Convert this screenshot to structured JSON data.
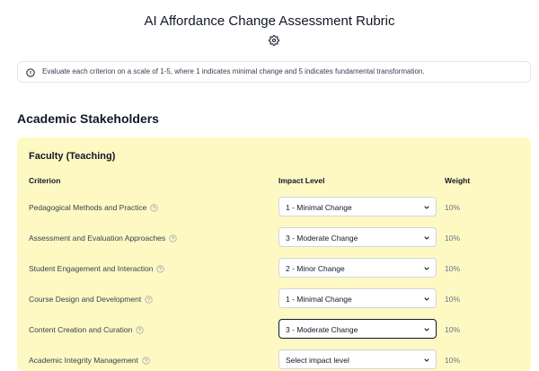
{
  "header": {
    "title": "AI Affordance Change Assessment Rubric",
    "settings_icon": "gear-icon"
  },
  "info": {
    "icon": "info-icon",
    "text": "Evaluate each criterion on a scale of 1-5, where 1 indicates minimal change and 5 indicates fundamental transformation."
  },
  "section": {
    "title": "Academic Stakeholders"
  },
  "card": {
    "title": "Faculty (Teaching)",
    "background": "#fef9c3",
    "columns": {
      "criterion": "Criterion",
      "impact": "Impact Level",
      "weight": "Weight"
    },
    "rows": [
      {
        "criterion": "Pedagogical Methods and Practice",
        "impact": "1 - Minimal Change",
        "weight": "10%"
      },
      {
        "criterion": "Assessment and Evaluation Approaches",
        "impact": "3 - Moderate Change",
        "weight": "10%"
      },
      {
        "criterion": "Student Engagement and Interaction",
        "impact": "2 - Minor Change",
        "weight": "10%"
      },
      {
        "criterion": "Course Design and Development",
        "impact": "1 - Minimal Change",
        "weight": "10%"
      },
      {
        "criterion": "Content Creation and Curation",
        "impact": "3 - Moderate Change",
        "weight": "10%"
      },
      {
        "criterion": "Academic Integrity Management",
        "impact": "Select impact level",
        "weight": "10%"
      }
    ]
  }
}
